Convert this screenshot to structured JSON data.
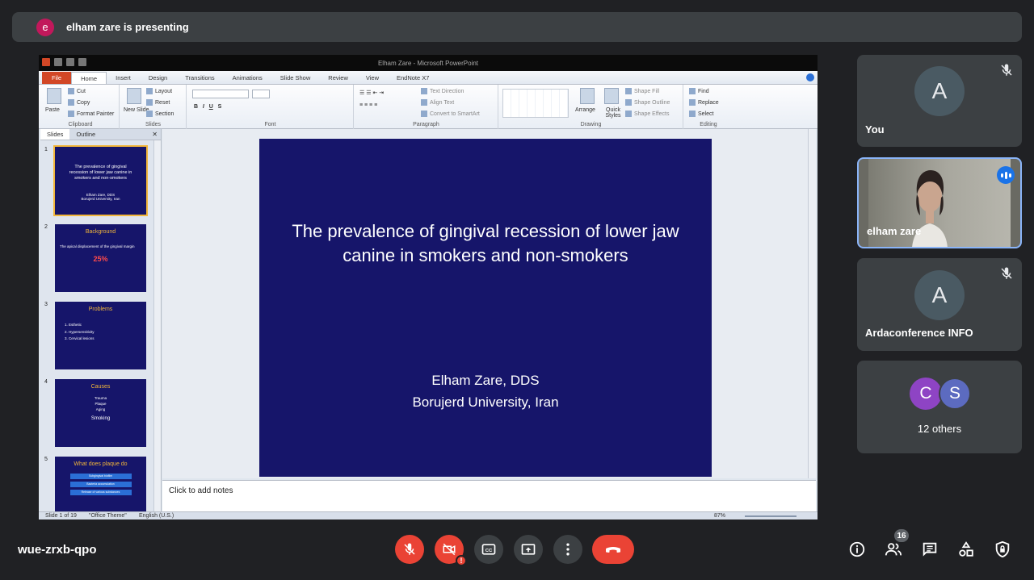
{
  "banner": {
    "avatar_letter": "e",
    "text": "elham zare is presenting"
  },
  "powerpoint": {
    "window_title": "Elham Zare - Microsoft PowerPoint",
    "tabs": [
      "File",
      "Home",
      "Insert",
      "Design",
      "Transitions",
      "Animations",
      "Slide Show",
      "Review",
      "View",
      "EndNote X7"
    ],
    "ribbon": {
      "clipboard": {
        "name": "Clipboard",
        "paste": "Paste",
        "cut": "Cut",
        "copy": "Copy",
        "format_painter": "Format Painter"
      },
      "slides": {
        "name": "Slides",
        "new_slide": "New Slide",
        "layout": "Layout",
        "reset": "Reset",
        "section": "Section"
      },
      "font": {
        "name": "Font"
      },
      "paragraph": {
        "name": "Paragraph",
        "text_direction": "Text Direction",
        "align_text": "Align Text",
        "smartart": "Convert to SmartArt"
      },
      "drawing": {
        "name": "Drawing",
        "arrange": "Arrange",
        "quick_styles": "Quick Styles",
        "shape_fill": "Shape Fill",
        "shape_outline": "Shape Outline",
        "shape_effects": "Shape Effects"
      },
      "editing": {
        "name": "Editing",
        "find": "Find",
        "replace": "Replace",
        "select": "Select"
      }
    },
    "panel_tabs": {
      "slides": "Slides",
      "outline": "Outline"
    },
    "thumbnails": [
      {
        "num": "1",
        "title": "The prevalence of gingival recession of lower jaw canine in smokers and non-smokers",
        "sub": "Elham Zare, DDS\nBorujerd University, Iran"
      },
      {
        "num": "2",
        "heading": "Background",
        "line": "The apical displacement of the gingival margin",
        "big": "25%"
      },
      {
        "num": "3",
        "heading": "Problems",
        "items": [
          "1.  Esthetic",
          "2.  Hypersensitivity",
          "3.  Cervical lesions"
        ]
      },
      {
        "num": "4",
        "heading": "Causes",
        "items": [
          "Trauma",
          "Plaque",
          "Aging"
        ],
        "extra": "Smoking"
      },
      {
        "num": "5",
        "heading": "What does plaque do",
        "bars": [
          "Subgingival biofilm",
          "Bacteria accumulation",
          "Release of various substances"
        ]
      }
    ],
    "slide": {
      "title": "The prevalence of gingival recession of lower jaw canine in smokers and non-smokers",
      "author": "Elham Zare, DDS",
      "affiliation": "Borujerd University, Iran"
    },
    "notes_placeholder": "Click to add notes",
    "status": {
      "slide": "Slide 1 of 19",
      "theme": "\"Office Theme\"",
      "language": "English (U.S.)",
      "zoom": "87%"
    }
  },
  "participants": [
    {
      "letter": "A",
      "name": "You",
      "muted": true
    },
    {
      "name": "elham zare",
      "speaking": true
    },
    {
      "letter": "A",
      "name": "Ardaconference INFO",
      "muted": true
    }
  ],
  "others": {
    "letters": [
      "C",
      "S"
    ],
    "label": "12 others"
  },
  "meeting_code": "wue-zrxb-qpo",
  "people_count": "16",
  "colors": {
    "accent": "#8ab4f8",
    "danger": "#ea4335",
    "slide_bg": "#16156a",
    "heading_yellow": "#f2b63a"
  }
}
